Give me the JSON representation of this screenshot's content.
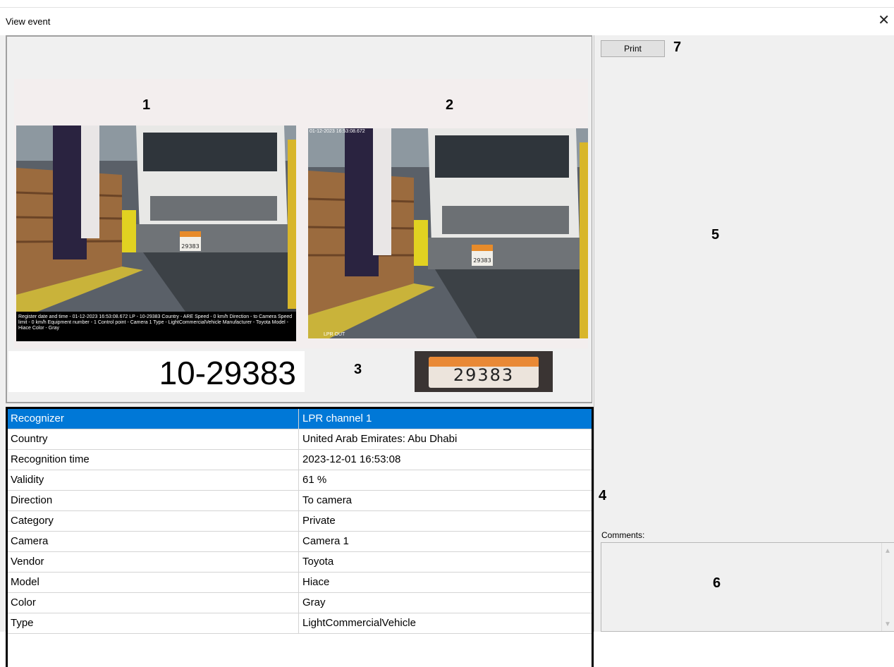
{
  "window": {
    "title": "View event",
    "close_glyph": "✕"
  },
  "images": {
    "first_caption": "Register date and time - 01-12-2023 16:53:08.672 LP - 10-29383 Country - ARE Speed - 0 km/h Direction - to Camera Speed limit - 0 km/h Equipment number - 1 Control point - Camera 1 Type - LightCommercialVehicle Manufacturer - Toyota Model - Hiace Color - Gray",
    "second_timestamp": "01-12-2023 16:53:08.672",
    "second_bottom_label": "LPR OUT",
    "plate_on_vehicle": "29383"
  },
  "plate": {
    "number": "10-29383",
    "crop_text": "29383"
  },
  "details": [
    {
      "key": "Recognizer",
      "value": "LPR channel  1",
      "selected": true
    },
    {
      "key": "Country",
      "value": "United Arab Emirates: Abu Dhabi"
    },
    {
      "key": "Recognition time",
      "value": "2023-12-01 16:53:08"
    },
    {
      "key": "Validity",
      "value": "61 %"
    },
    {
      "key": "Direction",
      "value": "To camera"
    },
    {
      "key": "Category",
      "value": "Private"
    },
    {
      "key": "Camera",
      "value": "Camera 1"
    },
    {
      "key": "Vendor",
      "value": "Toyota"
    },
    {
      "key": "Model",
      "value": "Hiace"
    },
    {
      "key": "Color",
      "value": "Gray"
    },
    {
      "key": "Type",
      "value": "LightCommercialVehicle"
    }
  ],
  "right_panel": {
    "print_label": "Print",
    "comments_label": "Comments:"
  },
  "annotations": {
    "n1": "1",
    "n2": "2",
    "n3": "3",
    "n4": "4",
    "n5": "5",
    "n6": "6",
    "n7": "7"
  },
  "colors": {
    "selection": "#0078d7",
    "panel_bg": "#f0f0f0"
  }
}
